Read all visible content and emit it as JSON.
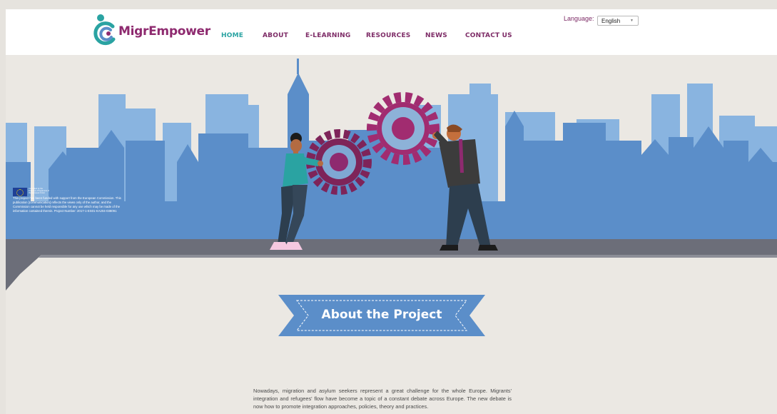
{
  "header": {
    "logo_text": "MigrEmpower",
    "nav": [
      {
        "label": "HOME",
        "active": true
      },
      {
        "label": "ABOUT",
        "active": false
      },
      {
        "label": "E-LEARNING",
        "active": false
      },
      {
        "label": "RESOURCES",
        "active": false
      },
      {
        "label": "NEWS",
        "active": false
      },
      {
        "label": "CONTACT US",
        "active": false
      }
    ],
    "language_label": "Language:",
    "language_value": "English"
  },
  "hero": {
    "eu_caption": "Co-funded by the Erasmus+ Programme of the European Union",
    "eu_notice": "This project has been funded with support from the European Commission. This publication [communication] reflects the views only of the author, and the Commission cannot be held responsible for any use which may be made of the information contained therein. Project Number: 2017-1-ES01-KA204-038091"
  },
  "about": {
    "title": "About the Project",
    "text": "Nowadays, migration and asylum seekers represent a great challenge for the whole Europe. Migrants' integration and refugees' flow have become a topic of a constant debate across Europe. The new debate is now how to promote integration approaches, policies, theory and practices."
  },
  "colors": {
    "brand_purple": "#8e2a6f",
    "brand_teal": "#2aa3a2",
    "sky_blue": "#5b8ec9",
    "gear_magenta": "#a12c70",
    "ribbon_blue": "#5b8ec9"
  }
}
